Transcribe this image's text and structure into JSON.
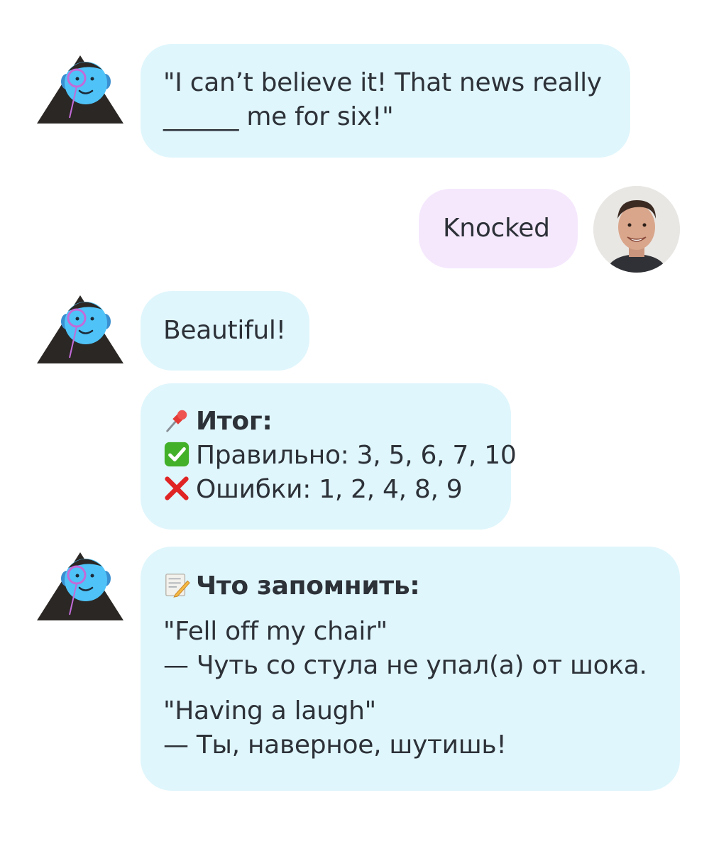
{
  "messages": [
    {
      "role": "bot",
      "lines": [
        "\"I can’t believe it! That news really",
        "______ me for six!\""
      ]
    },
    {
      "role": "user",
      "text": "Knocked"
    },
    {
      "role": "bot",
      "text": "Beautiful!"
    },
    {
      "role": "bot",
      "summary": {
        "icon": "pushpin-icon",
        "title": "Итог:",
        "correct_icon": "check-mark-icon",
        "correct": "Правильно: 3, 5, 6, 7, 10",
        "errors_icon": "cross-mark-icon",
        "errors": "Ошибки: 1, 2, 4, 8, 9"
      }
    },
    {
      "role": "bot",
      "memo": {
        "icon": "memo-icon",
        "title": "Что запомнить:",
        "items": [
          {
            "phrase": "\"Fell off my chair\"",
            "translation": "— Чуть со стула не упал(а) от шока."
          },
          {
            "phrase": "\"Having a laugh\"",
            "translation": "— Ты, наверное, шутишь!"
          }
        ]
      }
    }
  ],
  "colors": {
    "bot_bubble": "#dff6fc",
    "user_bubble": "#f5e8fd",
    "text": "#2d3138",
    "bot_avatar_face": "#4fc3f7",
    "bot_avatar_hair": "#2b2724",
    "monocle": "#c26bd9"
  }
}
